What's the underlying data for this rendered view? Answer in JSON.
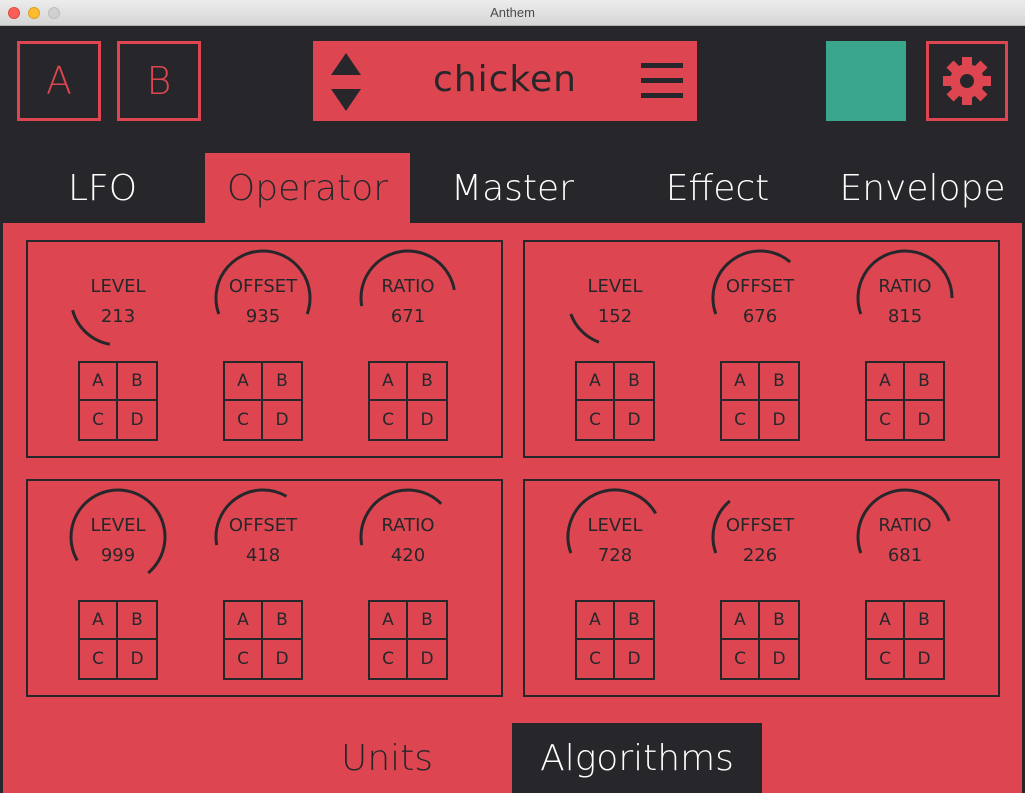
{
  "window": {
    "title": "Anthem"
  },
  "header": {
    "a_label": "A",
    "b_label": "B",
    "patch_name": "chicken",
    "accent_color": "#dd4650",
    "swatch_color": "#3aa68d",
    "background_color": "#27272b"
  },
  "tabs": [
    {
      "label": "LFO",
      "active": false
    },
    {
      "label": "Operator",
      "active": true
    },
    {
      "label": "Master",
      "active": false
    },
    {
      "label": "Effect",
      "active": false
    },
    {
      "label": "Envelope",
      "active": false
    }
  ],
  "operators": [
    {
      "knobs": [
        {
          "label": "LEVEL",
          "value": "213"
        },
        {
          "label": "OFFSET",
          "value": "935"
        },
        {
          "label": "RATIO",
          "value": "671"
        }
      ]
    },
    {
      "knobs": [
        {
          "label": "LEVEL",
          "value": "152"
        },
        {
          "label": "OFFSET",
          "value": "676"
        },
        {
          "label": "RATIO",
          "value": "815"
        }
      ]
    },
    {
      "knobs": [
        {
          "label": "LEVEL",
          "value": "999"
        },
        {
          "label": "OFFSET",
          "value": "418"
        },
        {
          "label": "RATIO",
          "value": "420"
        }
      ]
    },
    {
      "knobs": [
        {
          "label": "LEVEL",
          "value": "728"
        },
        {
          "label": "OFFSET",
          "value": "226"
        },
        {
          "label": "RATIO",
          "value": "681"
        }
      ]
    }
  ],
  "mod_cells": [
    "A",
    "B",
    "C",
    "D"
  ],
  "bottom_tabs": [
    {
      "label": "Units",
      "active": false
    },
    {
      "label": "Algorithms",
      "active": true
    }
  ]
}
